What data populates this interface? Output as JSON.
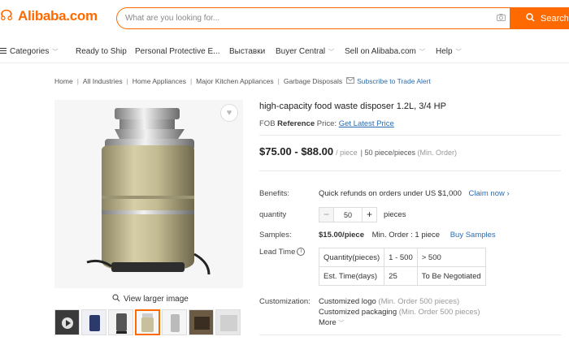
{
  "header": {
    "logo_text": "Alibaba.com",
    "search_placeholder": "What are you looking for...",
    "search_button": "Search"
  },
  "nav": {
    "items": [
      {
        "label": "Categories",
        "dropdown": true
      },
      {
        "label": "Ready to Ship",
        "dropdown": false
      },
      {
        "label": "Personal Protective E...",
        "dropdown": false
      },
      {
        "label": "Выставки",
        "dropdown": false
      },
      {
        "label": "Buyer Central",
        "dropdown": true
      },
      {
        "label": "Sell on Alibaba.com",
        "dropdown": true
      },
      {
        "label": "Help",
        "dropdown": true
      }
    ]
  },
  "breadcrumb": {
    "items": [
      "Home",
      "All Industries",
      "Home Appliances",
      "Major Kitchen Appliances",
      "Garbage Disposals"
    ],
    "trade_alert": "Subscribe to Trade Alert"
  },
  "gallery": {
    "view_larger": "View larger image",
    "thumbnail_count": 7,
    "active_thumbnail": 3
  },
  "product": {
    "title": "high-capacity food waste disposer 1.2L, 3/4 HP",
    "fob_prefix": "FOB",
    "fob_bold": "Reference",
    "fob_suffix": "Price:",
    "fob_link": "Get Latest Price",
    "price_range": "$75.00 - $88.00",
    "price_unit": "/ piece",
    "moq_value": "50 piece/pieces",
    "moq_label": "(Min. Order)"
  },
  "details": {
    "benefits_label": "Benefits:",
    "benefits_text": "Quick refunds on orders under US $1,000",
    "claim_now": "Claim now",
    "quantity_label": "quantity",
    "quantity_value": "50",
    "quantity_unit": "pieces",
    "samples_label": "Samples:",
    "sample_price": "$15.00/piece",
    "sample_min": "Min. Order : 1 piece",
    "buy_samples": "Buy Samples",
    "lead_time_label": "Lead Time",
    "lead_table": {
      "row1": [
        "Quantity(pieces)",
        "1 - 500",
        "> 500"
      ],
      "row2": [
        "Est. Time(days)",
        "25",
        "To Be Negotiated"
      ]
    },
    "customization_label": "Customization:",
    "custom_logo": "Customized logo",
    "custom_logo_min": "(Min. Order 500 pieces)",
    "custom_packaging": "Customized packaging",
    "custom_packaging_min": "(Min. Order 500 pieces)",
    "more": "More"
  },
  "colors": {
    "brand": "#ff6a00",
    "link": "#2b6cb0"
  }
}
